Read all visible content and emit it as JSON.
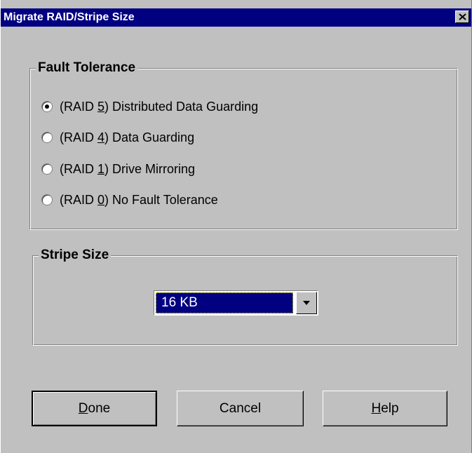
{
  "window": {
    "title": "Migrate RAID/Stripe Size",
    "close_icon": "close-x-icon"
  },
  "fault_tolerance": {
    "legend": "Fault Tolerance",
    "options": [
      {
        "pre": "(RAID ",
        "key": "5",
        "post": ") Distributed Data Guarding",
        "selected": true
      },
      {
        "pre": "(RAID ",
        "key": "4",
        "post": ") Data Guarding",
        "selected": false
      },
      {
        "pre": "(RAID ",
        "key": "1",
        "post": ") Drive Mirroring",
        "selected": false
      },
      {
        "pre": "(RAID ",
        "key": "0",
        "post": ") No Fault Tolerance",
        "selected": false
      }
    ]
  },
  "stripe_size": {
    "legend": "Stripe Size",
    "selected_value": "16 KB"
  },
  "buttons": {
    "done_key": "D",
    "done_rest": "one",
    "cancel": "Cancel",
    "help_key": "H",
    "help_rest": "elp"
  },
  "colors": {
    "titlebar": "#000080",
    "face": "#c0c0c0",
    "selection": "#000080"
  }
}
